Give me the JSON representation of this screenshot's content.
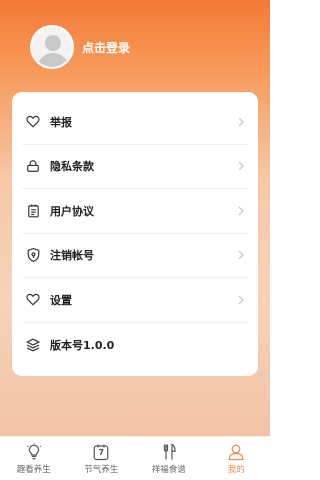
{
  "header": {
    "login_label": "点击登录"
  },
  "menu": {
    "items": [
      {
        "label": "举报",
        "icon": "heart-icon"
      },
      {
        "label": "隐私条款",
        "icon": "lock-icon"
      },
      {
        "label": "用户协议",
        "icon": "document-icon"
      },
      {
        "label": "注销帐号",
        "icon": "shield-icon"
      },
      {
        "label": "设置",
        "icon": "heart-icon"
      },
      {
        "label": "版本号1.0.0",
        "icon": "layers-icon"
      }
    ]
  },
  "tabbar": {
    "tabs": [
      {
        "label": "趣看养生",
        "icon": "lightbulb-icon",
        "active": false
      },
      {
        "label": "节气养生",
        "icon": "calendar-icon",
        "active": false,
        "icon_text": "7"
      },
      {
        "label": "祥福食谱",
        "icon": "cutlery-icon",
        "active": false
      },
      {
        "label": "我的",
        "icon": "user-icon",
        "active": true
      }
    ]
  },
  "colors": {
    "accent": "#f08a4b",
    "header_top": "#f57a36",
    "text": "#222222"
  }
}
